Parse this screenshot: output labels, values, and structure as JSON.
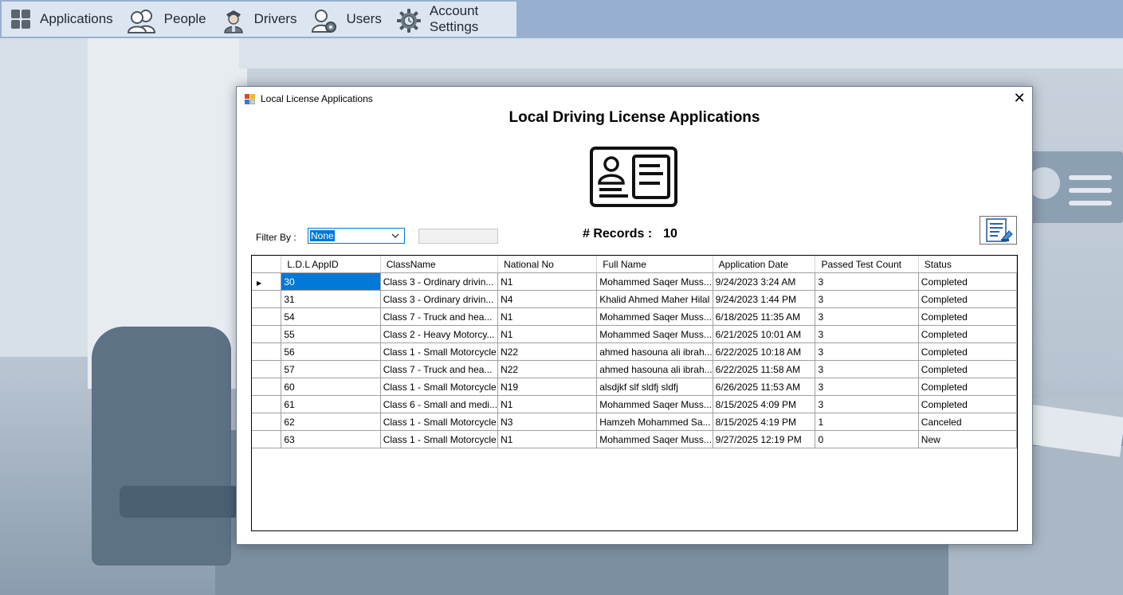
{
  "menu": {
    "items": [
      {
        "label": "Applications",
        "icon": "applications-grid-icon"
      },
      {
        "label": "People",
        "icon": "people-icon"
      },
      {
        "label": "Drivers",
        "icon": "driver-icon"
      },
      {
        "label": "Users",
        "icon": "user-settings-icon"
      },
      {
        "label": "Account Settings",
        "icon": "gear-icon"
      }
    ]
  },
  "dialog": {
    "window_title": "Local License Applications",
    "heading": "Local Driving License Applications",
    "filter_label": "Filter By :",
    "filter_value": "None",
    "records_label": "# Records :",
    "records_count": "10"
  },
  "grid": {
    "columns": [
      "L.D.L AppID",
      "ClassName",
      "National No",
      "Full Name",
      "Application Date",
      "Passed Test Count",
      "Status"
    ],
    "rows": [
      [
        "30",
        "Class 3 - Ordinary drivin...",
        "N1",
        "Mohammed Saqer Muss...",
        "9/24/2023 3:24 AM",
        "3",
        "Completed"
      ],
      [
        "31",
        "Class 3 - Ordinary drivin...",
        "N4",
        "Khalid Ahmed Maher Hilal",
        "9/24/2023 1:44 PM",
        "3",
        "Completed"
      ],
      [
        "54",
        "Class 7 - Truck and hea...",
        "N1",
        "Mohammed Saqer Muss...",
        "6/18/2025 11:35 AM",
        "3",
        "Completed"
      ],
      [
        "55",
        "Class 2 - Heavy Motorcy...",
        "N1",
        "Mohammed Saqer Muss...",
        "6/21/2025 10:01 AM",
        "3",
        "Completed"
      ],
      [
        "56",
        "Class 1 - Small Motorcycle",
        "N22",
        "ahmed hasouna ali ibrah...",
        "6/22/2025 10:18 AM",
        "3",
        "Completed"
      ],
      [
        "57",
        "Class 7 - Truck and hea...",
        "N22",
        "ahmed hasouna ali ibrah...",
        "6/22/2025 11:58 AM",
        "3",
        "Completed"
      ],
      [
        "60",
        "Class 1 - Small Motorcycle",
        "N19",
        "alsdjkf slf sldfj sldfj",
        "6/26/2025 11:53 AM",
        "3",
        "Completed"
      ],
      [
        "61",
        "Class 6 - Small and medi...",
        "N1",
        "Mohammed Saqer Muss...",
        "8/15/2025 4:09 PM",
        "3",
        "Completed"
      ],
      [
        "62",
        "Class 1 - Small Motorcycle",
        "N3",
        "Hamzeh Mohammed Sa...",
        "8/15/2025 4:19 PM",
        "1",
        "Canceled"
      ],
      [
        "63",
        "Class 1 - Small Motorcycle",
        "N1",
        "Mohammed Saqer Muss...",
        "9/27/2025 12:19 PM",
        "0",
        "New"
      ]
    ],
    "selected_row": 0
  },
  "colors": {
    "accent": "#0078d7",
    "menu_bar": "#98b0cf",
    "menu_background": "#dce6f1"
  }
}
